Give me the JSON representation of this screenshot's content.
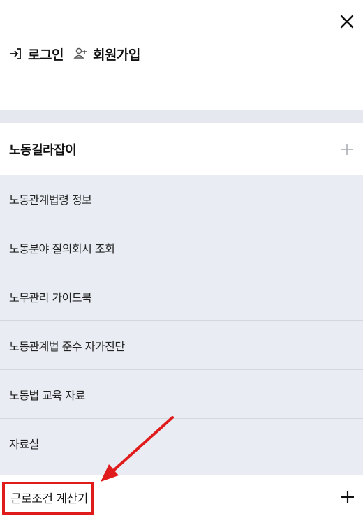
{
  "header": {
    "close_icon": "close-icon"
  },
  "auth": {
    "login_label": "로그인",
    "login_icon": "login-arrow-icon",
    "signup_label": "회원가입",
    "signup_icon": "user-plus-icon"
  },
  "menu": {
    "section_title": "노동길라잡이",
    "section_icon": "plus-icon",
    "items": [
      {
        "label": "노동관계법령 정보"
      },
      {
        "label": "노동분야 질의회시 조회"
      },
      {
        "label": "노무관리 가이드북"
      },
      {
        "label": "노동관계법 준수 자가진단"
      },
      {
        "label": "노동법 교육 자료"
      },
      {
        "label": "자료실"
      }
    ],
    "next_section_title": "근로조건 계산기",
    "next_section_icon": "plus-icon"
  },
  "annotation": {
    "highlight_color": "#e01b1b",
    "arrow_icon": "red-arrow-annotation"
  },
  "colors": {
    "submenu_bg": "#e9ecf2",
    "divider_bg": "#e5e8ef",
    "text": "#111111",
    "muted_plus": "#a9adb3"
  }
}
